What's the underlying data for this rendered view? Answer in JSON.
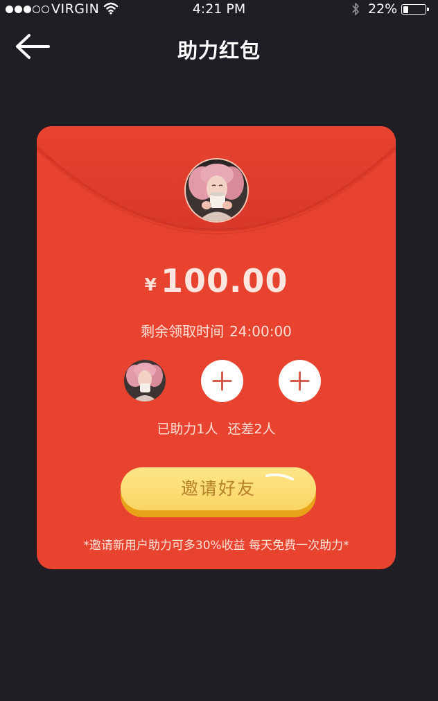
{
  "status_bar": {
    "carrier": "VIRGIN",
    "time": "4:21 PM",
    "battery": "22%",
    "battery_level": 0.22,
    "signal_bars_filled": 3,
    "signal_bars_total": 5,
    "icons": [
      "wifi-icon",
      "bluetooth-icon",
      "battery-icon"
    ]
  },
  "nav": {
    "title": "助力红包",
    "back_icon": "arrow-left-icon"
  },
  "card": {
    "currency_symbol": "¥",
    "amount": "100.00",
    "countdown_label": "剩余领取时间",
    "countdown_time": "24:00:00",
    "helped_text": "已助力1人",
    "remaining_text": "还差2人",
    "helpers_joined": 1,
    "helper_slots_total": 3,
    "empty_slot_icon": "plus-icon",
    "invite_button": "邀请好友",
    "footnote": "*邀请新用户助力可多30%收益 每天免费一次助力*"
  },
  "colors": {
    "background": "#1e1e24",
    "card_red": "#e8432f",
    "button_yellow": "#fbd564",
    "button_text": "#b8822a"
  }
}
